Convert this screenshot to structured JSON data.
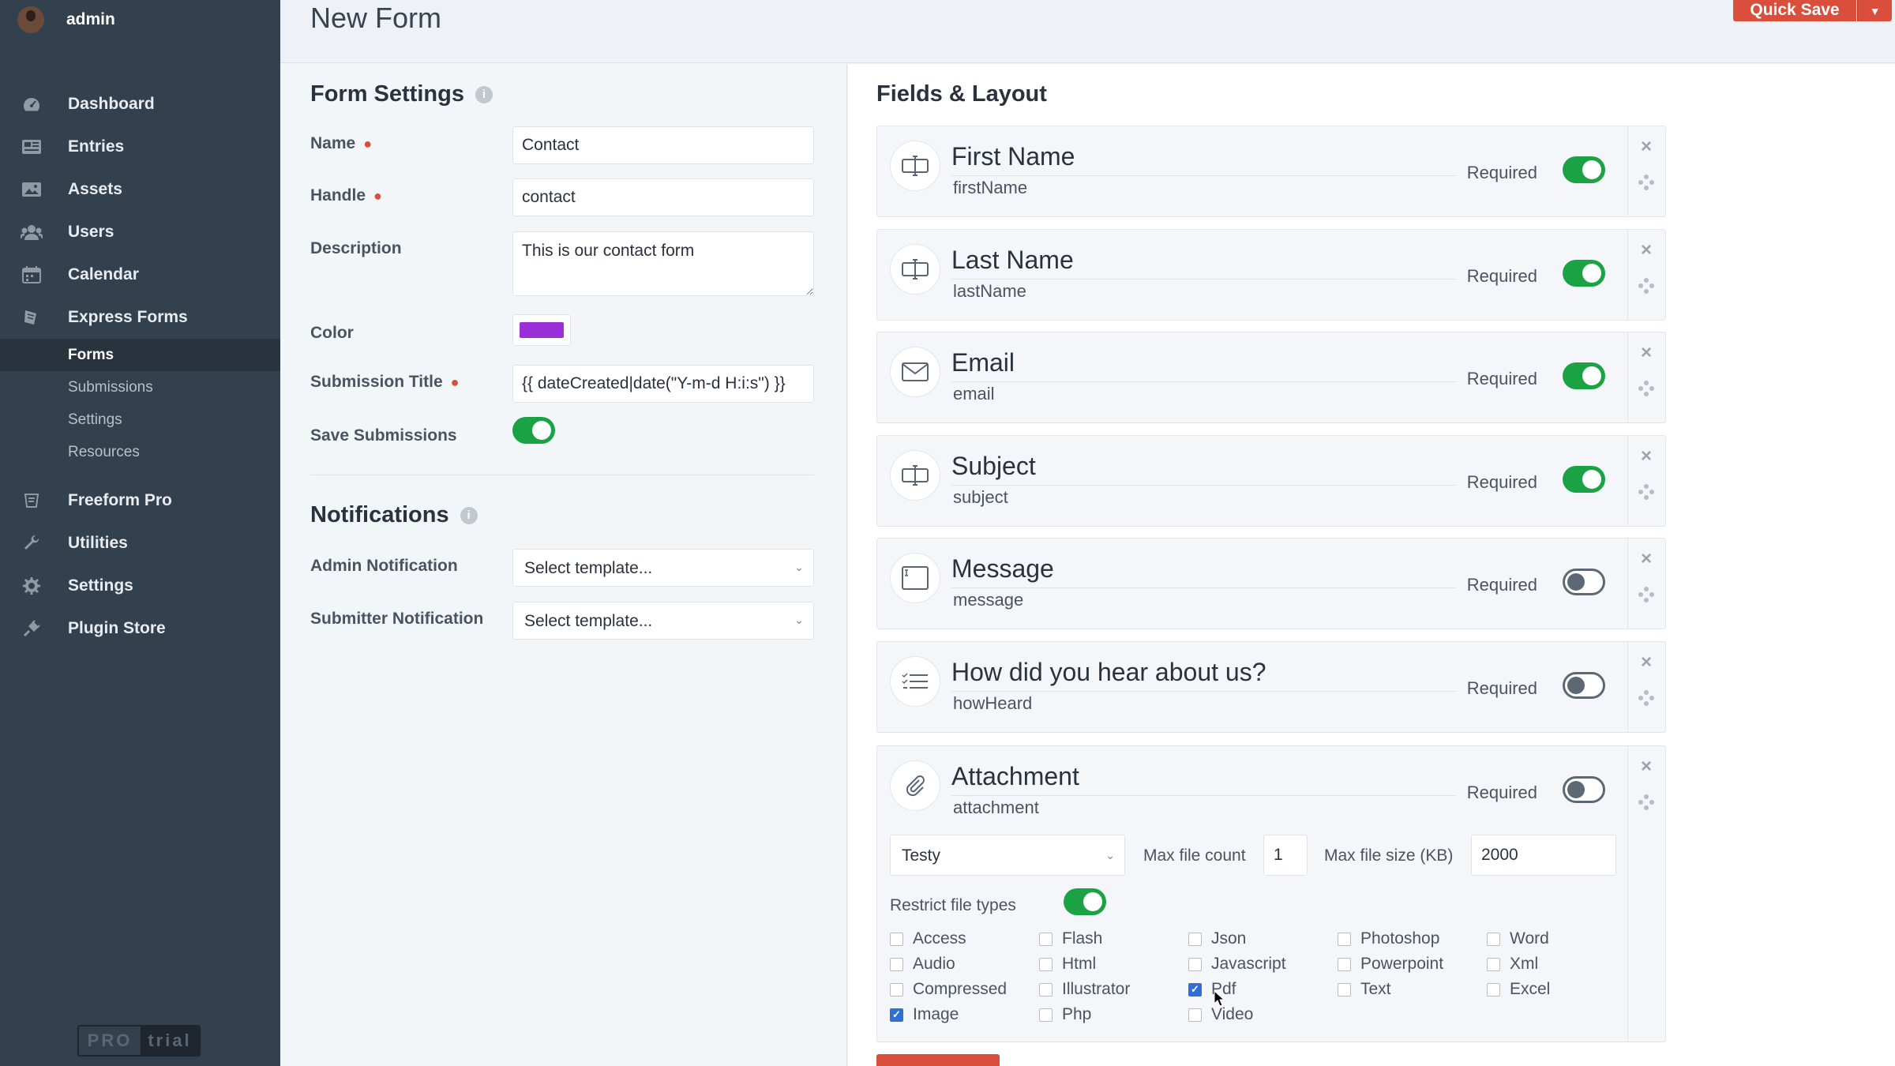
{
  "user": {
    "name": "admin"
  },
  "nav": {
    "items": [
      {
        "label": "Dashboard",
        "icon": "gauge-icon"
      },
      {
        "label": "Entries",
        "icon": "newspaper-icon"
      },
      {
        "label": "Assets",
        "icon": "image-icon"
      },
      {
        "label": "Users",
        "icon": "users-icon"
      },
      {
        "label": "Calendar",
        "icon": "calendar-icon"
      },
      {
        "label": "Express Forms",
        "icon": "forms-icon"
      }
    ],
    "subitems": [
      "Forms",
      "Submissions",
      "Settings",
      "Resources"
    ],
    "items2": [
      {
        "label": "Freeform Pro",
        "icon": "freeform-icon"
      },
      {
        "label": "Utilities",
        "icon": "wrench-icon"
      },
      {
        "label": "Settings",
        "icon": "gear-icon"
      },
      {
        "label": "Plugin Store",
        "icon": "plug-icon"
      }
    ]
  },
  "badge": {
    "pro": "PRO",
    "trial": "trial"
  },
  "header": {
    "title": "New Form",
    "quick_save": "Quick Save"
  },
  "settings": {
    "title": "Form Settings",
    "name_label": "Name",
    "name_value": "Contact",
    "handle_label": "Handle",
    "handle_value": "contact",
    "description_label": "Description",
    "description_value": "This is our contact form",
    "color_label": "Color",
    "color_value": "#9b30d9",
    "submission_title_label": "Submission Title",
    "submission_title_value": "{{ dateCreated|date(\"Y-m-d H:i:s\") }}",
    "save_submissions_label": "Save Submissions"
  },
  "notifications": {
    "title": "Notifications",
    "admin_label": "Admin Notification",
    "admin_value": "Select template...",
    "submitter_label": "Submitter Notification",
    "submitter_value": "Select template..."
  },
  "fields": {
    "title": "Fields & Layout",
    "required_label": "Required",
    "items": [
      {
        "title": "First Name",
        "handle": "firstName",
        "required": true,
        "icon": "text-input-icon"
      },
      {
        "title": "Last Name",
        "handle": "lastName",
        "required": true,
        "icon": "text-input-icon"
      },
      {
        "title": "Email",
        "handle": "email",
        "required": true,
        "icon": "envelope-icon"
      },
      {
        "title": "Subject",
        "handle": "subject",
        "required": true,
        "icon": "text-input-icon"
      },
      {
        "title": "Message",
        "handle": "message",
        "required": false,
        "icon": "textarea-icon"
      },
      {
        "title": "How did you hear about us?",
        "handle": "howHeard",
        "required": false,
        "icon": "checklist-icon"
      }
    ],
    "attachment": {
      "title": "Attachment",
      "handle": "attachment",
      "required": false,
      "volume": "Testy",
      "max_count_label": "Max file count",
      "max_count_value": "1",
      "max_size_label": "Max file size (KB)",
      "max_size_value": "2000",
      "restrict_label": "Restrict file types",
      "restrict": true,
      "file_types": [
        {
          "label": "Access",
          "checked": false
        },
        {
          "label": "Flash",
          "checked": false
        },
        {
          "label": "Json",
          "checked": false
        },
        {
          "label": "Photoshop",
          "checked": false
        },
        {
          "label": "Word",
          "checked": false
        },
        {
          "label": "Audio",
          "checked": false
        },
        {
          "label": "Html",
          "checked": false
        },
        {
          "label": "Javascript",
          "checked": false
        },
        {
          "label": "Powerpoint",
          "checked": false
        },
        {
          "label": "Xml",
          "checked": false
        },
        {
          "label": "Compressed",
          "checked": false
        },
        {
          "label": "Illustrator",
          "checked": false
        },
        {
          "label": "Pdf",
          "checked": true
        },
        {
          "label": "Text",
          "checked": false
        },
        {
          "label": "Excel",
          "checked": false
        },
        {
          "label": "Image",
          "checked": true
        },
        {
          "label": "Php",
          "checked": false
        },
        {
          "label": "Video",
          "checked": false
        }
      ]
    }
  },
  "colors": {
    "sidebar": "#33404d",
    "accent": "#da4f3c",
    "toggle_on": "#1aa244",
    "checkbox": "#2f6fd8"
  }
}
